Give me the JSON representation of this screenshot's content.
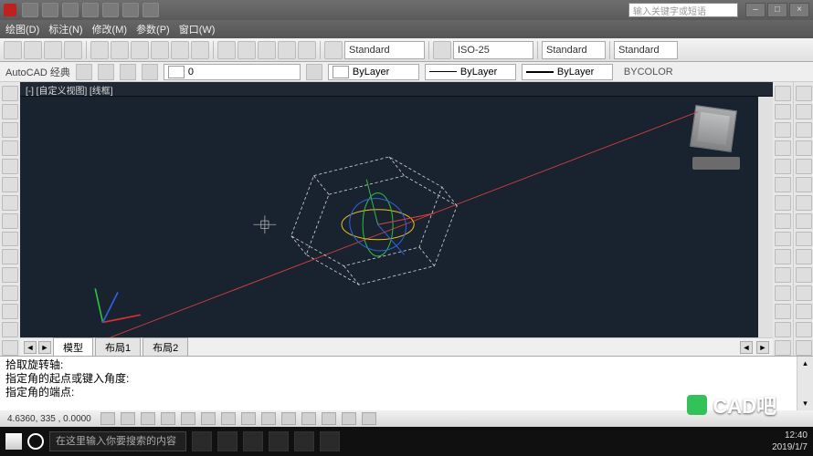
{
  "title_search_placeholder": "输入关键字或短语",
  "menubar": {
    "items": [
      "绘图(D)",
      "标注(N)",
      "修改(M)",
      "参数(P)",
      "窗口(W)"
    ]
  },
  "ribbon": {
    "standard": "Standard",
    "iso": "ISO-25",
    "std2": "Standard",
    "std3": "Standard"
  },
  "layer_row": {
    "label": "AutoCAD 经典",
    "zero": "0",
    "bylayer": "ByLayer",
    "bylayer2": "ByLayer",
    "bylayer3": "ByLayer",
    "bycolor": "BYCOLOR"
  },
  "canvas": {
    "header": "[-] [自定义视图] [线框]"
  },
  "tabs": {
    "model": "模型",
    "layout1": "布局1",
    "layout2": "布局2"
  },
  "cmd": {
    "l1": "拾取旋转轴:",
    "l2": "指定角的起点或键入角度:",
    "l3": "指定角的端点:"
  },
  "status": {
    "coords": "4.6360, 335    , 0.0000"
  },
  "taskbar": {
    "search": "在这里输入你要搜索的内容",
    "time": "12:40",
    "date": "2019/1/7"
  },
  "watermark": "CAD吧"
}
